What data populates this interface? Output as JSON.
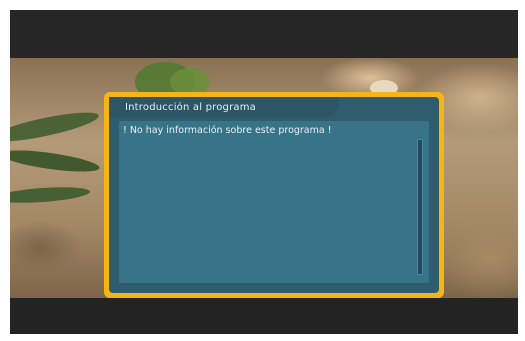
{
  "info_dialog": {
    "title": "Introducción al programa",
    "message": "! No hay información sobre este programa !"
  },
  "colors": {
    "dialog_border": "#f3b51a",
    "dialog_background": "#2f5d6e",
    "dialog_body": "#37748a",
    "text": "#e9eff2"
  },
  "scrollbar": {
    "position_fraction": 0
  }
}
